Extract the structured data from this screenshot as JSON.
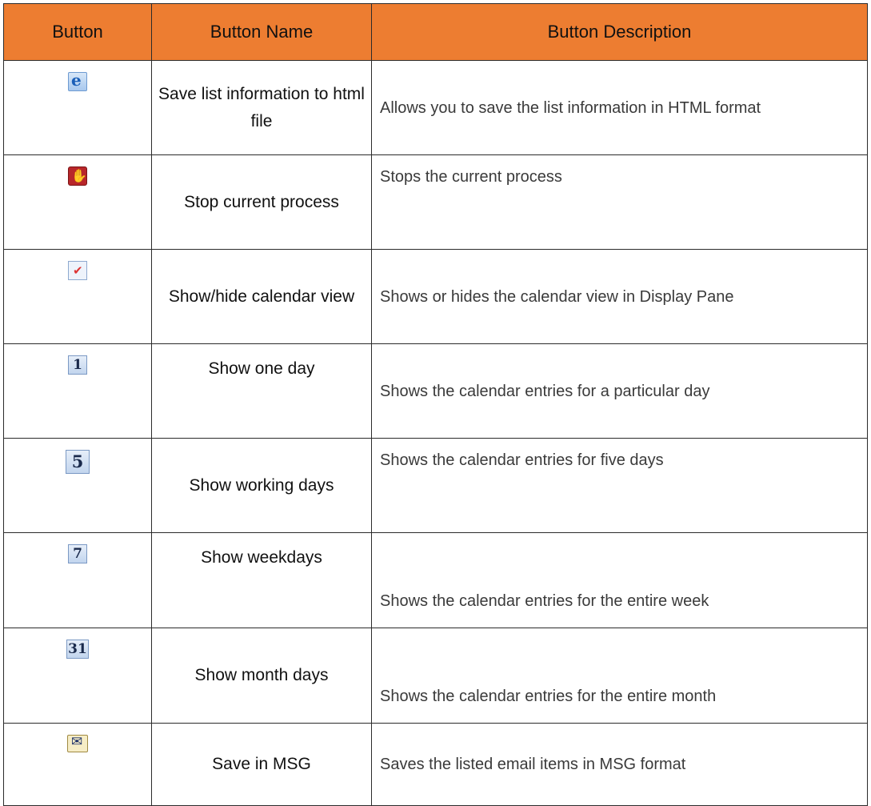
{
  "headers": [
    "Button",
    "Button Name",
    "Button Description"
  ],
  "rows": [
    {
      "icon": "html-save-icon",
      "name": "Save list information to html file",
      "desc": "Allows you to save the list information in HTML format"
    },
    {
      "icon": "stop-icon",
      "name": "Stop current process",
      "desc": "Stops the current process"
    },
    {
      "icon": "calendar-check-icon",
      "name": "Show/hide calendar view",
      "desc": "Shows or hides the calendar view in Display Pane"
    },
    {
      "icon": "calendar-day-1-icon",
      "badge": "1",
      "name": "Show one day",
      "desc": "Shows the calendar entries for a particular day"
    },
    {
      "icon": "calendar-day-5-icon",
      "badge": "5",
      "name": "Show working days",
      "desc": "Shows the calendar entries for five days"
    },
    {
      "icon": "calendar-day-7-icon",
      "badge": "7",
      "name": "Show weekdays",
      "desc": "Shows the calendar entries for the entire week"
    },
    {
      "icon": "calendar-day-31-icon",
      "badge": "31",
      "name": "Show month days",
      "desc": "Shows the calendar entries for the entire month"
    },
    {
      "icon": "envelope-icon",
      "name": "Save in MSG",
      "desc": "Saves the listed email items in MSG format"
    }
  ]
}
